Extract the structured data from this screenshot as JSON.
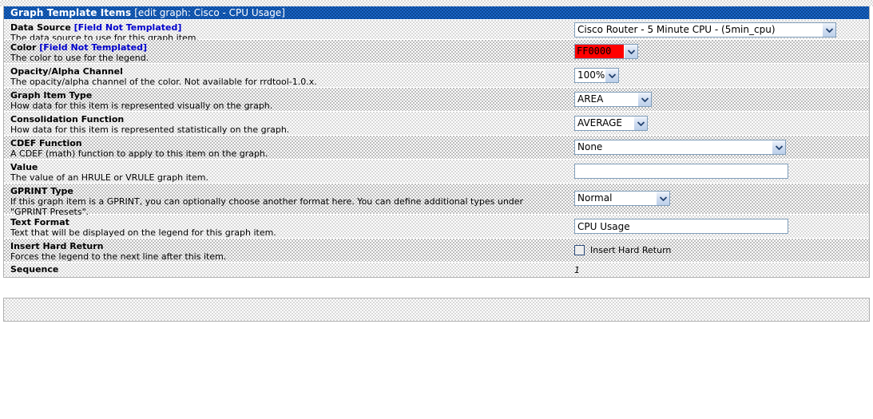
{
  "header": {
    "title": "Graph Template Items",
    "subtitle": "[edit graph: Cisco - CPU Usage]"
  },
  "colors": {
    "header_bg": "#0A4896",
    "template_link": "#0000CC",
    "color_swatch": "#FF0000",
    "control_border": "#7F9DB9"
  },
  "rows": [
    {
      "name": "Data Source",
      "template_flag": "[Field Not Templated]",
      "desc": "The data source to use for this graph item.",
      "control": "select",
      "value": "Cisco Router - 5 Minute CPU - (5min_cpu)"
    },
    {
      "name": "Color",
      "template_flag": "[Field Not Templated]",
      "desc": "The color to use for the legend.",
      "control": "color-select",
      "value": "FF0000"
    },
    {
      "name": "Opacity/Alpha Channel",
      "template_flag": "",
      "desc": "The opacity/alpha channel of the color. Not available for rrdtool-1.0.x.",
      "control": "select",
      "value": "100%"
    },
    {
      "name": "Graph Item Type",
      "template_flag": "",
      "desc": "How data for this item is represented visually on the graph.",
      "control": "select",
      "value": "AREA"
    },
    {
      "name": "Consolidation Function",
      "template_flag": "",
      "desc": "How data for this item is represented statistically on the graph.",
      "control": "select",
      "value": "AVERAGE"
    },
    {
      "name": "CDEF Function",
      "template_flag": "",
      "desc": "A CDEF (math) function to apply to this item on the graph.",
      "control": "select",
      "value": "None"
    },
    {
      "name": "Value",
      "template_flag": "",
      "desc": "The value of an HRULE or VRULE graph item.",
      "control": "text",
      "value": "",
      "placeholder": ""
    },
    {
      "name": "GPRINT Type",
      "template_flag": "",
      "desc": "If this graph item is a GPRINT, you can optionally choose another format here. You can define additional types under \"GPRINT Presets\".",
      "control": "select",
      "value": "Normal"
    },
    {
      "name": "Text Format",
      "template_flag": "",
      "desc": "Text that will be displayed on the legend for this graph item.",
      "control": "text",
      "value": "CPU Usage",
      "placeholder": ""
    },
    {
      "name": "Insert Hard Return",
      "template_flag": "",
      "desc": "Forces the legend to the next line after this item.",
      "control": "checkbox",
      "value": "Insert Hard Return",
      "checked": false
    },
    {
      "name": "Sequence",
      "template_flag": "",
      "desc": "",
      "control": "static",
      "value": "1"
    }
  ],
  "icons": {
    "dropdown": "chevron-down-icon"
  }
}
